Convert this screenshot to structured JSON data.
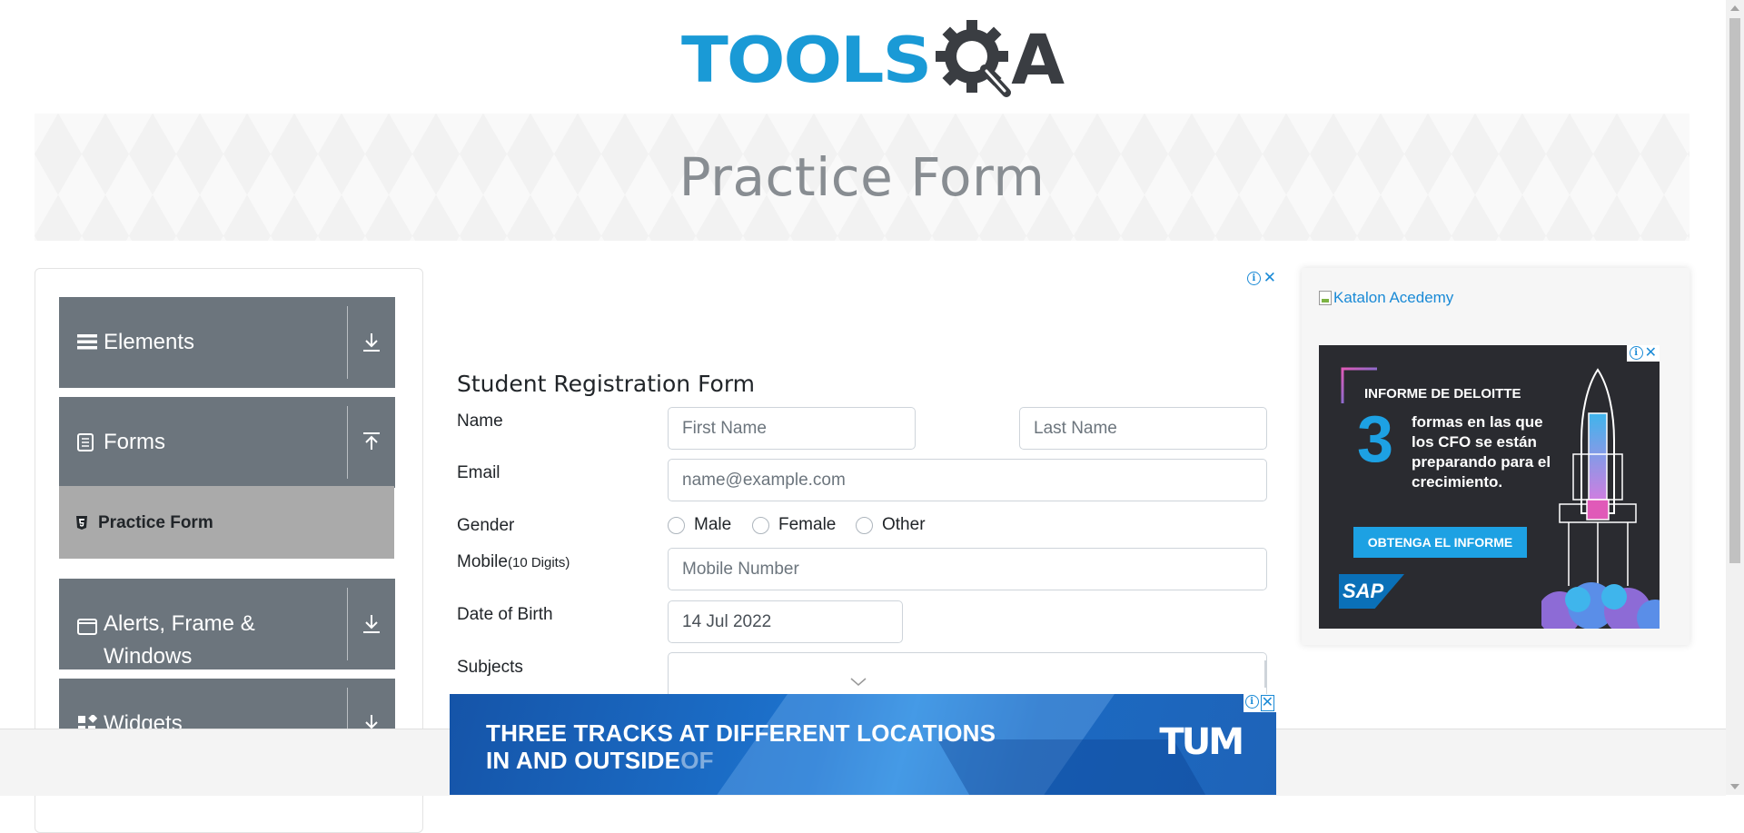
{
  "header": {
    "logo_part1": "TOOLS",
    "logo_part2": "A",
    "logo_colors": {
      "tools": "#1a9ad6",
      "qa": "#3a3d42"
    }
  },
  "banner": {
    "title": "Practice Form"
  },
  "sidebar": {
    "groups": [
      {
        "label": "Elements",
        "icon": "hamburger-icon",
        "state": "collapsed"
      },
      {
        "label": "Forms",
        "icon": "document-icon",
        "state": "expanded"
      },
      {
        "label": "Alerts, Frame & Windows",
        "icon": "window-icon",
        "state": "collapsed"
      },
      {
        "label": "Widgets",
        "icon": "widgets-icon",
        "state": "collapsed"
      }
    ],
    "active_item": {
      "label": "Practice Form",
      "icon": "html5-icon"
    }
  },
  "form": {
    "title": "Student Registration Form",
    "name_label": "Name",
    "first_name_placeholder": "First Name",
    "last_name_placeholder": "Last Name",
    "email_label": "Email",
    "email_placeholder": "name@example.com",
    "gender_label": "Gender",
    "gender_options": [
      "Male",
      "Female",
      "Other"
    ],
    "mobile_label": "Mobile",
    "mobile_hint": "(10 Digits)",
    "mobile_placeholder": "Mobile Number",
    "dob_label": "Date of Birth",
    "dob_value": "14 Jul 2022",
    "subjects_label": "Subjects"
  },
  "right_ad": {
    "katalon_alt": "Katalon Acedemy",
    "deloitte_title": "INFORME DE DELOITTE",
    "big_number": "3",
    "description": "formas en las que los CFO se están preparando para el crecimiento.",
    "cta": "OBTENGA EL INFORME",
    "brand": "SAP"
  },
  "bottom_ad": {
    "line1": "THREE TRACKS AT DIFFERENT LOCATIONS",
    "line2": "IN AND OUTSIDE",
    "line2_faded": "OF",
    "brand": "TUM"
  }
}
